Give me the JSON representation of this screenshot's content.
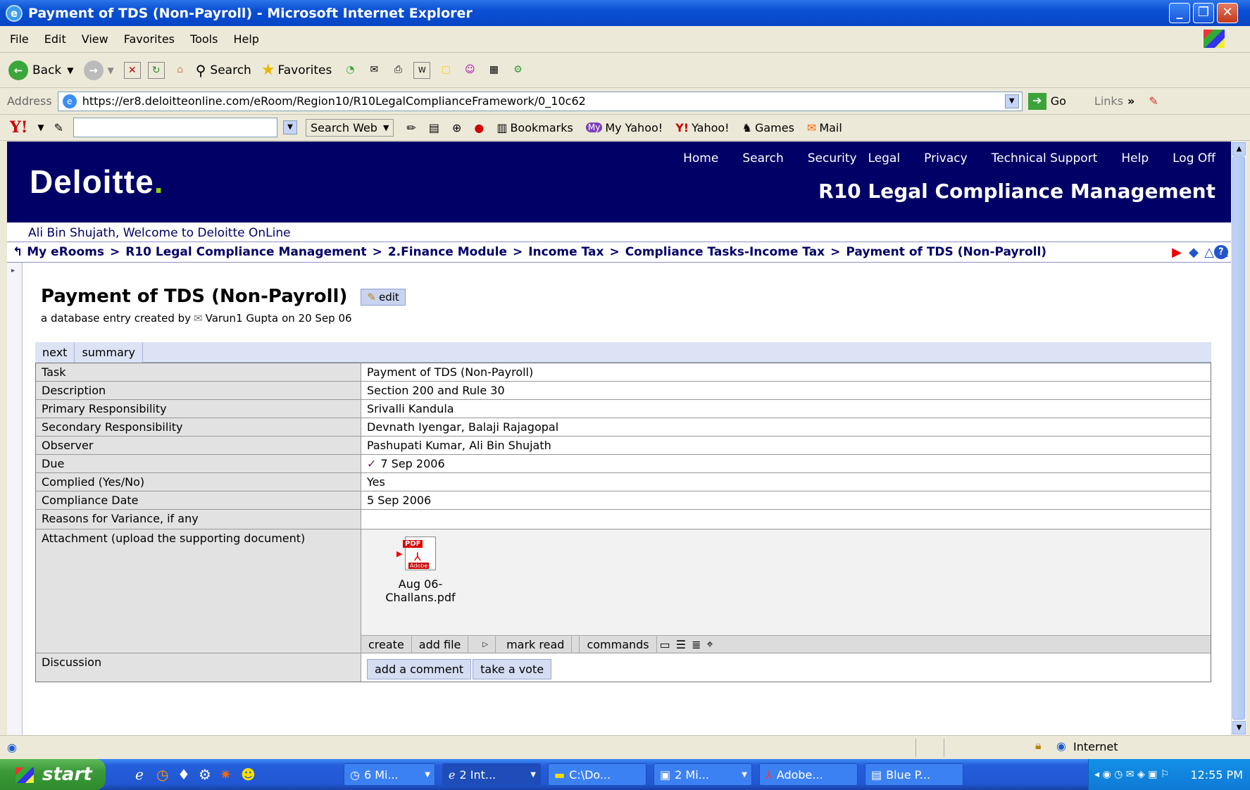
{
  "window": {
    "title": "Payment of TDS (Non-Payroll) - Microsoft Internet Explorer",
    "min": "_",
    "max": "❐",
    "close": "✕"
  },
  "menu": [
    "File",
    "Edit",
    "View",
    "Favorites",
    "Tools",
    "Help"
  ],
  "toolbar": {
    "back": "Back",
    "search": "Search",
    "favorites": "Favorites"
  },
  "address": {
    "label": "Address",
    "url": "https://er8.deloitteonline.com/eRoom/Region10/R10LegalComplianceFramework/0_10c62",
    "go": "Go",
    "links": "Links"
  },
  "yahoo": {
    "search_web": "Search Web",
    "bookmarks": "Bookmarks",
    "my_yahoo": "My Yahoo!",
    "yahoo": "Yahoo!",
    "games": "Games",
    "mail": "Mail"
  },
  "site": {
    "logo": "Deloitte",
    "logo_dot": ".",
    "nav": [
      "Home",
      "Search",
      "Security",
      "Legal",
      "Privacy",
      "Technical Support",
      "Help",
      "Log Off"
    ],
    "app_title": "R10 Legal Compliance Management",
    "welcome": "Ali Bin Shujath, Welcome to Deloitte OnLine"
  },
  "breadcrumb": [
    "My eRooms",
    "R10 Legal Compliance Management",
    "2.Finance Module",
    "Income Tax",
    "Compliance Tasks-Income Tax",
    "Payment of TDS (Non-Payroll)"
  ],
  "entry": {
    "title": "Payment of TDS (Non-Payroll)",
    "edit": "edit",
    "created_prefix": "a database entry created by",
    "author": "Varun1 Gupta",
    "created_suffix": "on 20 Sep 06"
  },
  "tabs": [
    "next",
    "summary"
  ],
  "fields": [
    {
      "label": "Task",
      "value": "Payment of TDS (Non-Payroll)"
    },
    {
      "label": "Description",
      "value": "Section 200 and Rule 30"
    },
    {
      "label": "Primary Responsibility",
      "value": "Srivalli Kandula"
    },
    {
      "label": "Secondary Responsibility",
      "value": "Devnath Iyengar, Balaji Rajagopal"
    },
    {
      "label": "Observer",
      "value": "Pashupati Kumar, Ali Bin Shujath"
    },
    {
      "label": "Due",
      "value": "7 Sep 2006"
    },
    {
      "label": "Complied (Yes/No)",
      "value": "Yes"
    },
    {
      "label": "Compliance Date",
      "value": "5 Sep 2006"
    },
    {
      "label": "Reasons for Variance, if any",
      "value": ""
    }
  ],
  "attachment": {
    "label": "Attachment (upload the supporting document)",
    "file_line1": "Aug 06-",
    "file_line2": "Challans.pdf",
    "pdf_badge": "PDF",
    "adobe": "Adobe",
    "commands": [
      "create",
      "add file",
      "mark read",
      "commands"
    ]
  },
  "discussion": {
    "label": "Discussion",
    "add_comment": "add a comment",
    "take_vote": "take a vote"
  },
  "status": {
    "zone": "Internet"
  },
  "taskbar": {
    "start": "start",
    "tasks": [
      "6 Mi...",
      "2 Int...",
      "C:\\Do...",
      "2 Mi...",
      "Adobe...",
      "Blue P..."
    ],
    "clock": "12:55 PM"
  }
}
